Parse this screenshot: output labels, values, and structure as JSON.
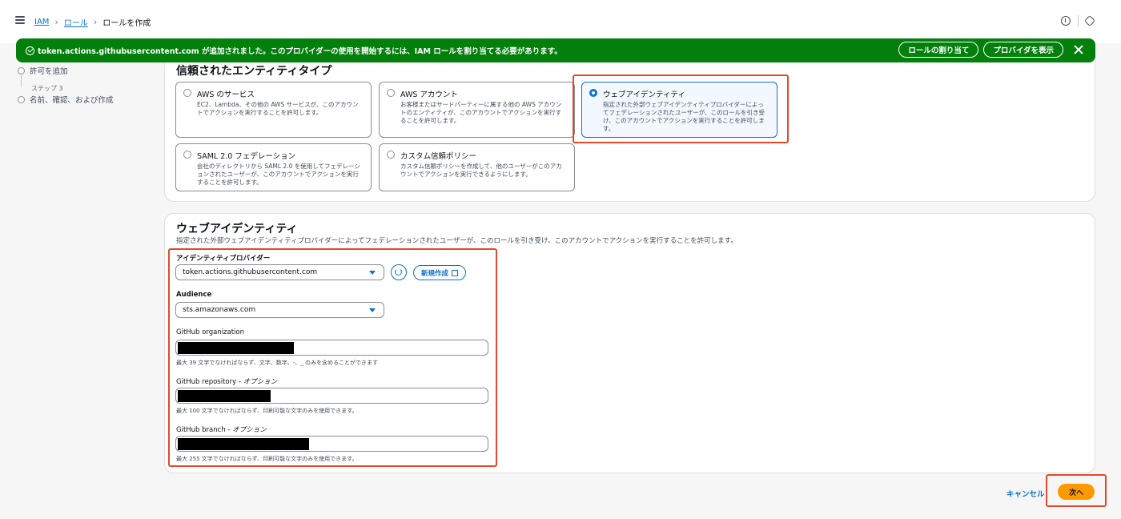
{
  "breadcrumb": {
    "items": [
      "IAM",
      "ロール"
    ],
    "current": "ロールを作成"
  },
  "flash": {
    "message": "token.actions.githubusercontent.com が追加されました。このプロバイダーの使用を開始するには、IAM ロールを割り当てる必要があります。",
    "assign_role_label": "ロールの割り当て",
    "view_provider_label": "プロバイダを表示",
    "color": "#037f0c"
  },
  "steps": [
    {
      "label": "許可を追加"
    },
    {
      "number": "ステップ 3",
      "label": "名前、確認、および作成"
    }
  ],
  "trusted_entity": {
    "title": "信頼されたエンティティタイプ",
    "tiles": [
      {
        "title": "AWS のサービス",
        "desc": "EC2、Lambda、その他の AWS サービスが、このアカウントでアクションを実行することを許可します。",
        "selected": false
      },
      {
        "title": "AWS アカウント",
        "desc": "お客様またはサードパーティーに属する他の AWS アカウントのエンティティが、このアカウントでアクションを実行することを許可します。",
        "selected": false
      },
      {
        "title": "ウェブアイデンティティ",
        "desc": "指定された外部ウェブアイデンティティプロバイダーによってフェデレーションされたユーザーが、このロールを引き受け、このアカウントでアクションを実行することを許可します。",
        "selected": true
      },
      {
        "title": "SAML 2.0 フェデレーション",
        "desc": "会社のディレクトリから SAML 2.0 を使用してフェデレーションされたユーザーが、このアカウントでアクションを実行することを許可します。",
        "selected": false
      },
      {
        "title": "カスタム信頼ポリシー",
        "desc": "カスタム信頼ポリシーを作成して、他のユーザーがこのアカウントでアクションを実行できるようにします。",
        "selected": false
      }
    ]
  },
  "web_identity": {
    "title": "ウェブアイデンティティ",
    "description": "指定された外部ウェブアイデンティティプロバイダーによってフェデレーションされたユーザーが、このロールを引き受け、このアカウントでアクションを実行することを許可します。",
    "provider_label": "アイデンティティプロバイダー",
    "provider_value": "token.actions.githubusercontent.com",
    "new_label": "新規作成",
    "audience_label": "Audience",
    "audience_value": "sts.amazonaws.com",
    "org_label": "GitHub organization",
    "org_constraint": "最大 39 文字でなければならず、文字、数字、-、_ のみを含めることができます",
    "repo_label": "GitHub repository",
    "repo_optional": "オプション",
    "repo_constraint": "最大 100 文字でなければならず、印刷可能な文字のみを使用できます。",
    "branch_label": "GitHub branch",
    "branch_optional": "オプション",
    "branch_constraint": "最大 255 文字でなければならず、印刷可能な文字のみを使用できます。"
  },
  "footer": {
    "cancel_label": "キャンセル",
    "next_label": "次へ",
    "next_color": "#ff9900"
  }
}
